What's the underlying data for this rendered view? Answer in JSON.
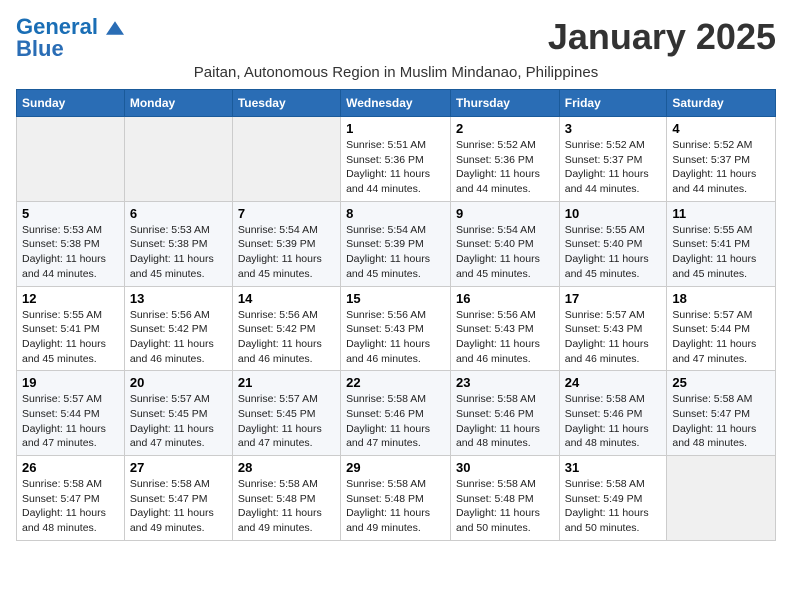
{
  "header": {
    "logo_general": "General",
    "logo_blue": "Blue",
    "month_title": "January 2025",
    "subtitle": "Paitan, Autonomous Region in Muslim Mindanao, Philippines"
  },
  "columns": [
    "Sunday",
    "Monday",
    "Tuesday",
    "Wednesday",
    "Thursday",
    "Friday",
    "Saturday"
  ],
  "weeks": [
    [
      {
        "day": "",
        "sunrise": "",
        "sunset": "",
        "daylight": ""
      },
      {
        "day": "",
        "sunrise": "",
        "sunset": "",
        "daylight": ""
      },
      {
        "day": "",
        "sunrise": "",
        "sunset": "",
        "daylight": ""
      },
      {
        "day": "1",
        "sunrise": "Sunrise: 5:51 AM",
        "sunset": "Sunset: 5:36 PM",
        "daylight": "Daylight: 11 hours and 44 minutes."
      },
      {
        "day": "2",
        "sunrise": "Sunrise: 5:52 AM",
        "sunset": "Sunset: 5:36 PM",
        "daylight": "Daylight: 11 hours and 44 minutes."
      },
      {
        "day": "3",
        "sunrise": "Sunrise: 5:52 AM",
        "sunset": "Sunset: 5:37 PM",
        "daylight": "Daylight: 11 hours and 44 minutes."
      },
      {
        "day": "4",
        "sunrise": "Sunrise: 5:52 AM",
        "sunset": "Sunset: 5:37 PM",
        "daylight": "Daylight: 11 hours and 44 minutes."
      }
    ],
    [
      {
        "day": "5",
        "sunrise": "Sunrise: 5:53 AM",
        "sunset": "Sunset: 5:38 PM",
        "daylight": "Daylight: 11 hours and 44 minutes."
      },
      {
        "day": "6",
        "sunrise": "Sunrise: 5:53 AM",
        "sunset": "Sunset: 5:38 PM",
        "daylight": "Daylight: 11 hours and 45 minutes."
      },
      {
        "day": "7",
        "sunrise": "Sunrise: 5:54 AM",
        "sunset": "Sunset: 5:39 PM",
        "daylight": "Daylight: 11 hours and 45 minutes."
      },
      {
        "day": "8",
        "sunrise": "Sunrise: 5:54 AM",
        "sunset": "Sunset: 5:39 PM",
        "daylight": "Daylight: 11 hours and 45 minutes."
      },
      {
        "day": "9",
        "sunrise": "Sunrise: 5:54 AM",
        "sunset": "Sunset: 5:40 PM",
        "daylight": "Daylight: 11 hours and 45 minutes."
      },
      {
        "day": "10",
        "sunrise": "Sunrise: 5:55 AM",
        "sunset": "Sunset: 5:40 PM",
        "daylight": "Daylight: 11 hours and 45 minutes."
      },
      {
        "day": "11",
        "sunrise": "Sunrise: 5:55 AM",
        "sunset": "Sunset: 5:41 PM",
        "daylight": "Daylight: 11 hours and 45 minutes."
      }
    ],
    [
      {
        "day": "12",
        "sunrise": "Sunrise: 5:55 AM",
        "sunset": "Sunset: 5:41 PM",
        "daylight": "Daylight: 11 hours and 45 minutes."
      },
      {
        "day": "13",
        "sunrise": "Sunrise: 5:56 AM",
        "sunset": "Sunset: 5:42 PM",
        "daylight": "Daylight: 11 hours and 46 minutes."
      },
      {
        "day": "14",
        "sunrise": "Sunrise: 5:56 AM",
        "sunset": "Sunset: 5:42 PM",
        "daylight": "Daylight: 11 hours and 46 minutes."
      },
      {
        "day": "15",
        "sunrise": "Sunrise: 5:56 AM",
        "sunset": "Sunset: 5:43 PM",
        "daylight": "Daylight: 11 hours and 46 minutes."
      },
      {
        "day": "16",
        "sunrise": "Sunrise: 5:56 AM",
        "sunset": "Sunset: 5:43 PM",
        "daylight": "Daylight: 11 hours and 46 minutes."
      },
      {
        "day": "17",
        "sunrise": "Sunrise: 5:57 AM",
        "sunset": "Sunset: 5:43 PM",
        "daylight": "Daylight: 11 hours and 46 minutes."
      },
      {
        "day": "18",
        "sunrise": "Sunrise: 5:57 AM",
        "sunset": "Sunset: 5:44 PM",
        "daylight": "Daylight: 11 hours and 47 minutes."
      }
    ],
    [
      {
        "day": "19",
        "sunrise": "Sunrise: 5:57 AM",
        "sunset": "Sunset: 5:44 PM",
        "daylight": "Daylight: 11 hours and 47 minutes."
      },
      {
        "day": "20",
        "sunrise": "Sunrise: 5:57 AM",
        "sunset": "Sunset: 5:45 PM",
        "daylight": "Daylight: 11 hours and 47 minutes."
      },
      {
        "day": "21",
        "sunrise": "Sunrise: 5:57 AM",
        "sunset": "Sunset: 5:45 PM",
        "daylight": "Daylight: 11 hours and 47 minutes."
      },
      {
        "day": "22",
        "sunrise": "Sunrise: 5:58 AM",
        "sunset": "Sunset: 5:46 PM",
        "daylight": "Daylight: 11 hours and 47 minutes."
      },
      {
        "day": "23",
        "sunrise": "Sunrise: 5:58 AM",
        "sunset": "Sunset: 5:46 PM",
        "daylight": "Daylight: 11 hours and 48 minutes."
      },
      {
        "day": "24",
        "sunrise": "Sunrise: 5:58 AM",
        "sunset": "Sunset: 5:46 PM",
        "daylight": "Daylight: 11 hours and 48 minutes."
      },
      {
        "day": "25",
        "sunrise": "Sunrise: 5:58 AM",
        "sunset": "Sunset: 5:47 PM",
        "daylight": "Daylight: 11 hours and 48 minutes."
      }
    ],
    [
      {
        "day": "26",
        "sunrise": "Sunrise: 5:58 AM",
        "sunset": "Sunset: 5:47 PM",
        "daylight": "Daylight: 11 hours and 48 minutes."
      },
      {
        "day": "27",
        "sunrise": "Sunrise: 5:58 AM",
        "sunset": "Sunset: 5:47 PM",
        "daylight": "Daylight: 11 hours and 49 minutes."
      },
      {
        "day": "28",
        "sunrise": "Sunrise: 5:58 AM",
        "sunset": "Sunset: 5:48 PM",
        "daylight": "Daylight: 11 hours and 49 minutes."
      },
      {
        "day": "29",
        "sunrise": "Sunrise: 5:58 AM",
        "sunset": "Sunset: 5:48 PM",
        "daylight": "Daylight: 11 hours and 49 minutes."
      },
      {
        "day": "30",
        "sunrise": "Sunrise: 5:58 AM",
        "sunset": "Sunset: 5:48 PM",
        "daylight": "Daylight: 11 hours and 50 minutes."
      },
      {
        "day": "31",
        "sunrise": "Sunrise: 5:58 AM",
        "sunset": "Sunset: 5:49 PM",
        "daylight": "Daylight: 11 hours and 50 minutes."
      },
      {
        "day": "",
        "sunrise": "",
        "sunset": "",
        "daylight": ""
      }
    ]
  ]
}
